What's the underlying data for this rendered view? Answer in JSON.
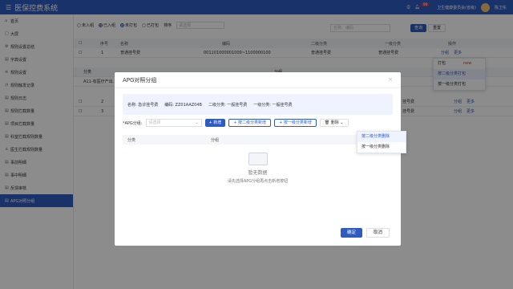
{
  "app": {
    "title": "医保控费系统",
    "user_org": "卫生健康委员会(省级)",
    "user_name": "陈卫东",
    "notif_count": "99"
  },
  "sidebar": {
    "items": [
      {
        "label": "首页",
        "icon": "⌂"
      },
      {
        "label": "大屏",
        "icon": "▢"
      },
      {
        "label": "规则设置总结",
        "icon": "⚙"
      },
      {
        "label": "字典设置",
        "icon": "▤"
      },
      {
        "label": "规则设置",
        "icon": "≡"
      },
      {
        "label": "规则触发记录",
        "icon": "◷"
      },
      {
        "label": "规则日志",
        "icon": "▤"
      },
      {
        "label": "规则拦截数量",
        "icon": "▤"
      },
      {
        "label": "项目拦截数量",
        "icon": "▤"
      },
      {
        "label": "科室拦截规则数量",
        "icon": "▤"
      },
      {
        "label": "医生拦截规则数量",
        "icon": "♙"
      },
      {
        "label": "事前明细",
        "icon": "▤"
      },
      {
        "label": "事中明细",
        "icon": "▤"
      },
      {
        "label": "反馈审核",
        "icon": "▤"
      },
      {
        "label": "APG对照分组",
        "icon": "▤"
      }
    ]
  },
  "filters": {
    "radios": [
      "未入组",
      "已入组",
      "未打包",
      "已打包"
    ],
    "sort_label": "排序",
    "select_placeholder": "请选择",
    "search_placeholder": "名称、编码",
    "query_btn": "查询",
    "reset_btn": "重置"
  },
  "table": {
    "headers": [
      "序号",
      "名称",
      "编码",
      "二级分类",
      "一级分类",
      "操作"
    ],
    "rows": [
      {
        "no": "1",
        "name": "普通挂号费",
        "code": "001101000001000~1100000100",
        "cat2": "普通挂号费",
        "cat1": "普通挂号费",
        "op1": "分组",
        "op2": "更多"
      },
      {
        "no": "2",
        "name": "",
        "code": "",
        "cat2": "",
        "cat1": "挂号费",
        "op1": "分组",
        "op2": "更多"
      },
      {
        "no": "3",
        "name": "",
        "code": "",
        "cat2": "",
        "cat1": "挂号费",
        "op1": "分组",
        "op2": "更多"
      }
    ],
    "sub_header": "分类",
    "sub_row": "A11-有医疗产出…",
    "sub_header2": "分组"
  },
  "row_menu": {
    "items": [
      "打包",
      "按二级分类打包",
      "按一级分类打包"
    ],
    "badge": "new"
  },
  "modal": {
    "title": "APG对照分组",
    "info": {
      "name": "名称: 急诊挂号费",
      "code": "编码: ZZ01AAZ04B",
      "cat2": "二级分类: 一般挂号费",
      "cat1": "一级分类: 一般挂号费"
    },
    "select_label": "*APG分组:",
    "select_placeholder": "请选择",
    "add_btn": "+ 新增",
    "add_cat2_btn": "+ 按二级分类新增",
    "add_cat1_btn": "+ 按一级分类新增",
    "delete_btn": "删除",
    "table_headers": [
      "分类",
      "分组"
    ],
    "empty_title": "暂无数据",
    "empty_hint": "请先选择APG分组再点击新增按钮",
    "ok_btn": "确定",
    "cancel_btn": "取消"
  },
  "delete_menu": {
    "items": [
      "按二级分类删除",
      "按一级分类删除"
    ]
  }
}
